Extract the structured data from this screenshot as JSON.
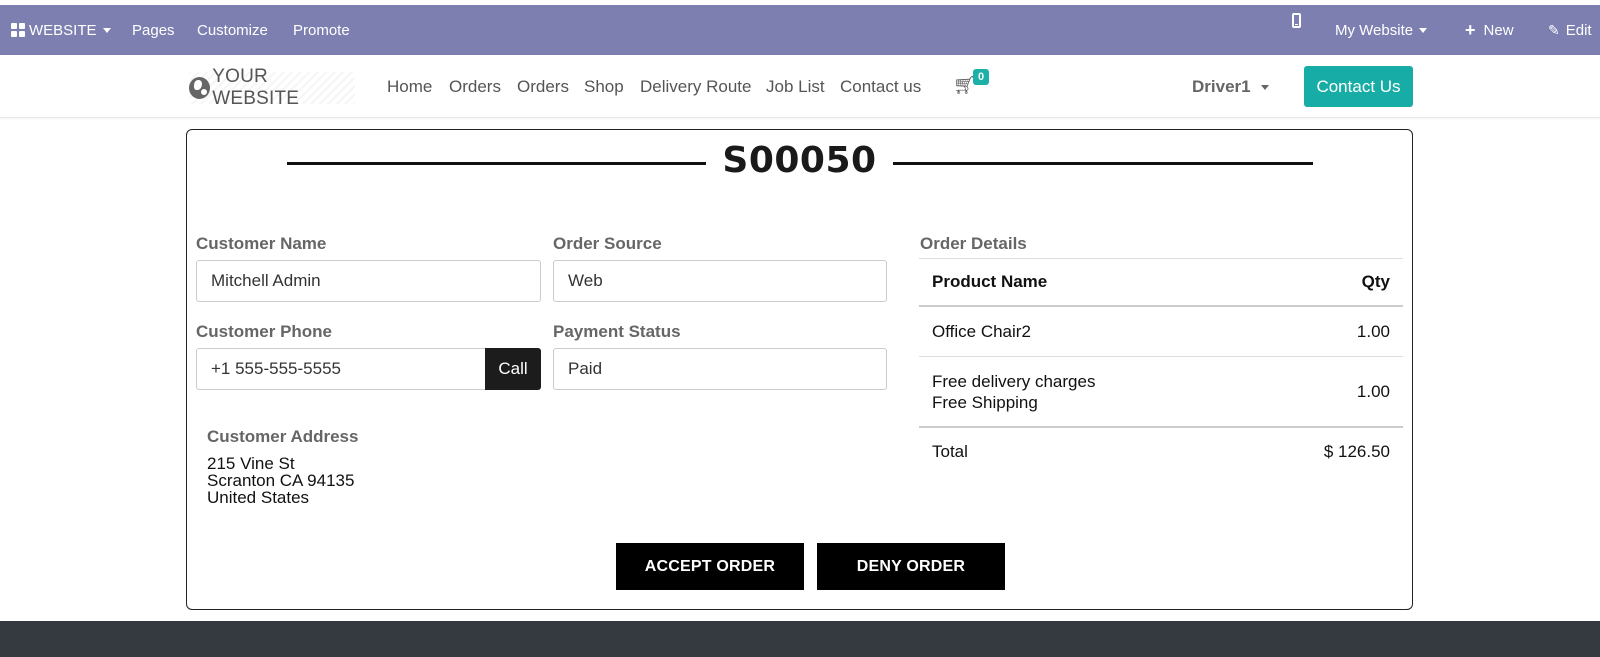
{
  "admin_bar": {
    "apps_label": "WEBSITE",
    "pages": "Pages",
    "customize": "Customize",
    "promote": "Promote",
    "my_website": "My Website",
    "new": "New",
    "edit": "Edit"
  },
  "navbar": {
    "logo_text": "YOUR WEBSITE",
    "links": [
      "Home",
      "Orders",
      "Orders",
      "Shop",
      "Delivery Route",
      "Job List",
      "Contact us"
    ],
    "cart_count": "0",
    "user": "Driver1",
    "contact_button": "Contact Us"
  },
  "order": {
    "title": "S00050",
    "customer_name_label": "Customer Name",
    "customer_name": "Mitchell Admin",
    "order_source_label": "Order Source",
    "order_source": "Web",
    "customer_phone_label": "Customer Phone",
    "customer_phone": "+1 555-555-5555",
    "call_button": "Call",
    "payment_status_label": "Payment Status",
    "payment_status": "Paid",
    "customer_address_label": "Customer Address",
    "address_lines": [
      "215 Vine St",
      "Scranton CA 94135",
      "United States"
    ],
    "order_details_label": "Order Details",
    "table_headers": {
      "product": "Product Name",
      "qty": "Qty"
    },
    "lines": [
      {
        "product": "Office Chair2",
        "qty": "1.00"
      },
      {
        "product": [
          "Free delivery charges",
          "Free Shipping"
        ],
        "qty": "1.00"
      }
    ],
    "total_label": "Total",
    "total_value": "$ 126.50",
    "accept_button": "ACCEPT ORDER",
    "deny_button": "DENY ORDER"
  },
  "colors": {
    "admin_bar": "#7c7fb0",
    "accent": "#17ada6",
    "footer": "#343a40"
  }
}
